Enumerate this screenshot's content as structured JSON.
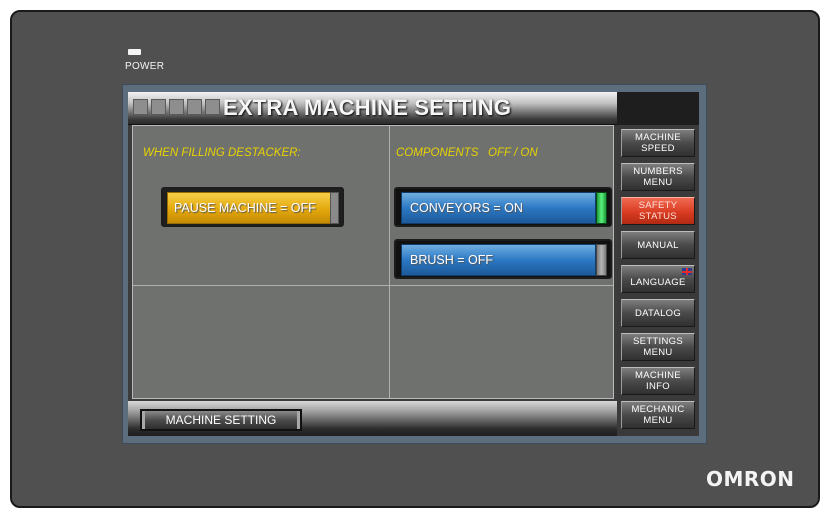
{
  "device": {
    "power_label": "POWER",
    "brand": "OMRON"
  },
  "screen": {
    "title": "EXTRA MACHINE SETTING",
    "sections": {
      "left_label": "WHEN FILLING DESTACKER:",
      "right_label": "COMPONENTS   OFF / ON"
    },
    "buttons": {
      "pause": {
        "label": "PAUSE MACHINE = OFF",
        "state": "OFF",
        "color": "#e3a80c"
      },
      "conveyors": {
        "label": "CONVEYORS = ON",
        "state": "ON",
        "color": "#2c78c3",
        "indicator": "green"
      },
      "brush": {
        "label": "BRUSH = OFF",
        "state": "OFF",
        "color": "#2c78c3",
        "indicator": "gray"
      }
    },
    "bottom_button": "MACHINE SETTING"
  },
  "menu": [
    {
      "label": "MACHINE\nSPEED",
      "active": false
    },
    {
      "label": "NUMBERS\nMENU",
      "active": false
    },
    {
      "label": "SAFETY\nSTATUS",
      "active": true,
      "color": "#d93c22"
    },
    {
      "label": "MANUAL",
      "active": false
    },
    {
      "label": "LANGUAGE",
      "active": false,
      "icon": "uk-flag-icon"
    },
    {
      "label": "DATALOG",
      "active": false
    },
    {
      "label": "SETTINGS\nMENU",
      "active": false
    },
    {
      "label": "MACHINE\nINFO",
      "active": false
    },
    {
      "label": "MECHANIC\nMENU",
      "active": false
    }
  ]
}
